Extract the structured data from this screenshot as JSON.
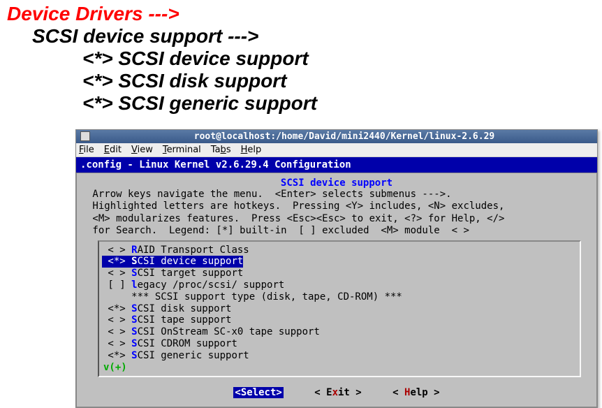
{
  "heading": {
    "red": "Device Drivers --->",
    "black": "SCSI device support --->",
    "items": [
      "<*> SCSI device support",
      "<*> SCSI disk support",
      "<*> SCSI generic support"
    ]
  },
  "terminal": {
    "title": "root@localhost:/home/David/mini2440/Kernel/linux-2.6.29",
    "menubar": {
      "file": "File",
      "edit": "Edit",
      "view": "View",
      "terminal": "Terminal",
      "tabs": "Tabs",
      "help": "Help"
    },
    "config_header": ".config - Linux Kernel v2.6.29.4 Configuration",
    "config_title": "SCSI device support",
    "help_lines": [
      " Arrow keys navigate the menu.  <Enter> selects submenus --->.",
      " Highlighted letters are hotkeys.  Pressing <Y> includes, <N> excludes,",
      " <M> modularizes features.  Press <Esc><Esc> to exit, <?> for Help, </>",
      " for Search.  Legend: [*] built-in  [ ] excluded  <M> module  < >"
    ],
    "menu_items": [
      {
        "mark": "< >",
        "hotkey": "R",
        "text": "AID Transport Class",
        "selected": false
      },
      {
        "mark": "<*>",
        "hotkey": "S",
        "text": "CSI device support",
        "selected": true
      },
      {
        "mark": "< >",
        "hotkey": "S",
        "text": "CSI target support",
        "selected": false
      },
      {
        "mark": "[ ]",
        "hotkey": "l",
        "text": "egacy /proc/scsi/ support",
        "selected": false
      },
      {
        "mark": "   ",
        "hotkey": "",
        "text": "*** SCSI support type (disk, tape, CD-ROM) ***",
        "selected": false
      },
      {
        "mark": "<*>",
        "hotkey": "S",
        "text": "CSI disk support",
        "selected": false
      },
      {
        "mark": "< >",
        "hotkey": "S",
        "text": "CSI tape support",
        "selected": false
      },
      {
        "mark": "< >",
        "hotkey": "S",
        "text": "CSI OnStream SC-x0 tape support",
        "selected": false
      },
      {
        "mark": "< >",
        "hotkey": "S",
        "text": "CSI CDROM support",
        "selected": false
      },
      {
        "mark": "<*>",
        "hotkey": "S",
        "text": "CSI generic support",
        "selected": false
      }
    ],
    "arrow_indicator": "v(+)",
    "buttons": {
      "select": "<Select>",
      "exit_pre": "< E",
      "exit_hot": "x",
      "exit_post": "it >",
      "help_pre": "< ",
      "help_hot": "H",
      "help_post": "elp >"
    }
  }
}
